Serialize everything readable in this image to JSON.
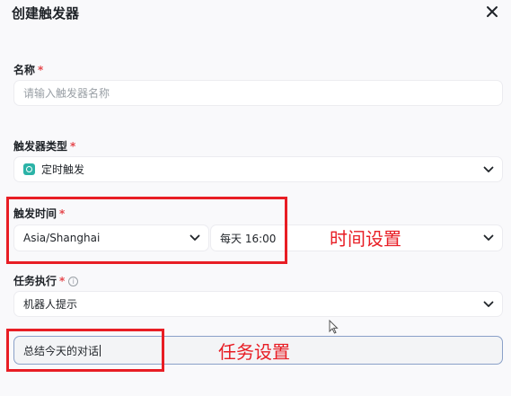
{
  "dialog": {
    "title": "创建触发器"
  },
  "name_field": {
    "label": "名称",
    "required_mark": "*",
    "placeholder": "请输入触发器名称"
  },
  "type_field": {
    "label": "触发器类型",
    "required_mark": "*",
    "value": "定时触发",
    "icon": "clock-icon"
  },
  "time_field": {
    "label": "触发时间",
    "required_mark": "*",
    "timezone": "Asia/Shanghai",
    "schedule": "每天 16:00"
  },
  "task_field": {
    "label": "任务执行",
    "required_mark": "*",
    "info_icon": "i",
    "value": "机器人提示",
    "text_value": "总结今天的对话"
  },
  "annotations": {
    "time_note": "时间设置",
    "task_note": "任务设置"
  },
  "colors": {
    "annotation": "#e81d24",
    "required": "#e5484d",
    "icon_accent": "#2bb3a7"
  }
}
